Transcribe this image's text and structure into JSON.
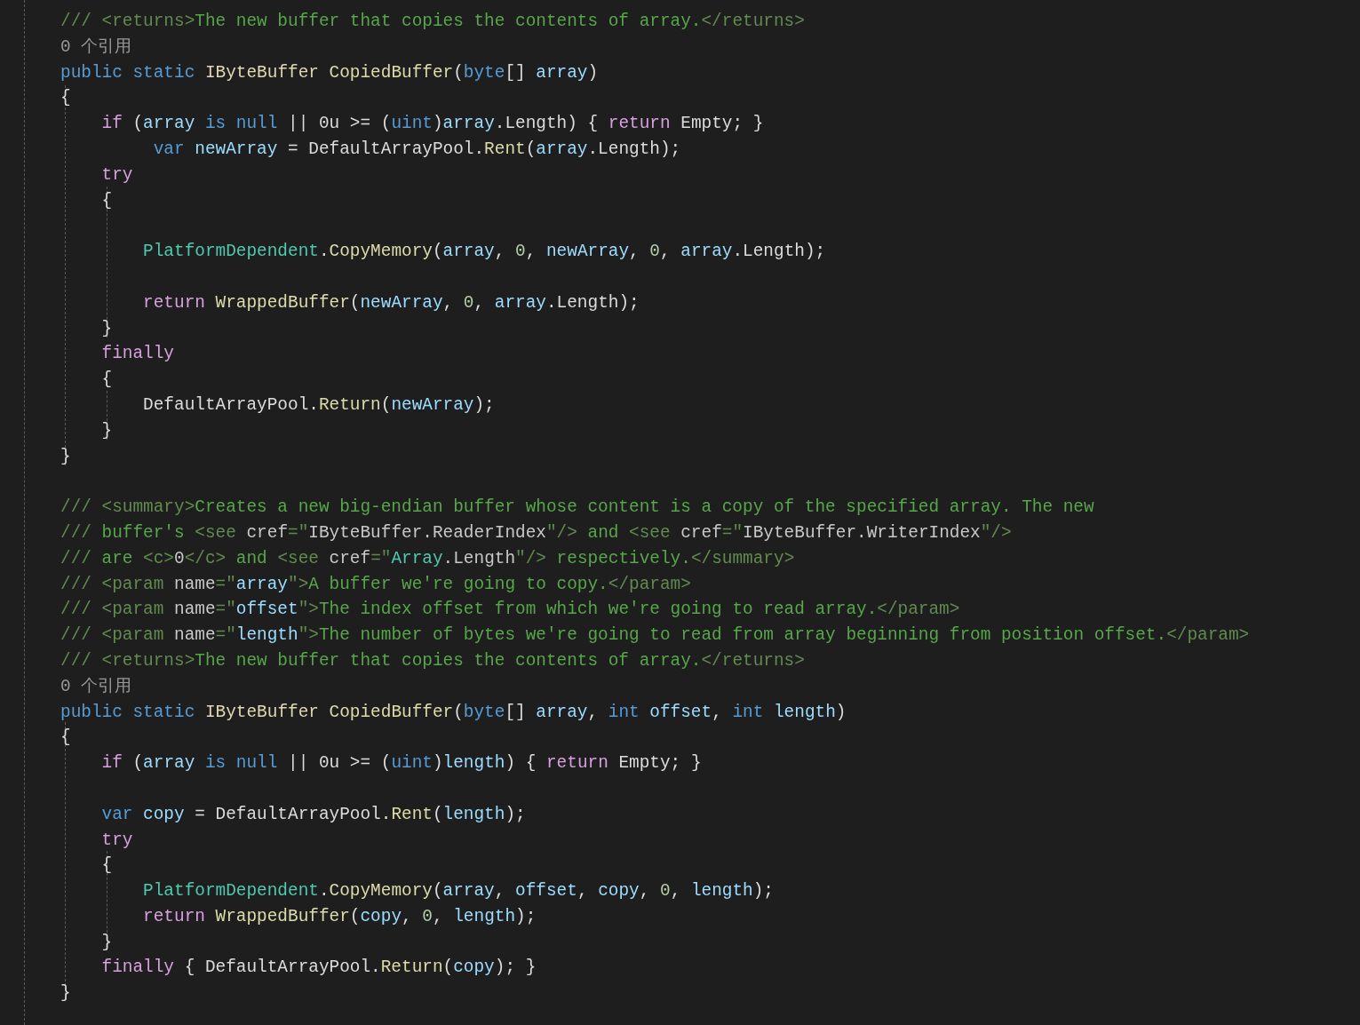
{
  "editor": {
    "lines": [
      {
        "kind": "code",
        "tokens": [
          {
            "text": "/// <returns>",
            "kind": "doc"
          },
          {
            "text": "The new buffer that copies the contents of array.",
            "kind": "comment"
          },
          {
            "text": "</returns>",
            "kind": "doc"
          }
        ]
      },
      {
        "kind": "lens",
        "text": "0 个引用"
      },
      {
        "kind": "code",
        "tokens": [
          {
            "text": "public static ",
            "kind": "keyword"
          },
          {
            "text": "IByteBuffer ",
            "kind": "interface"
          },
          {
            "text": "CopiedBuffer",
            "kind": "method"
          },
          {
            "text": "(",
            "kind": "plain"
          },
          {
            "text": "byte",
            "kind": "keyword"
          },
          {
            "text": "[] ",
            "kind": "plain"
          },
          {
            "text": "array",
            "kind": "variable"
          },
          {
            "text": ")",
            "kind": "plain"
          }
        ]
      },
      {
        "kind": "code",
        "tokens": [
          {
            "text": "{",
            "kind": "plain"
          }
        ]
      },
      {
        "kind": "code",
        "tokens": [
          {
            "text": "    if ",
            "kind": "control"
          },
          {
            "text": "(",
            "kind": "plain"
          },
          {
            "text": "array ",
            "kind": "variable"
          },
          {
            "text": "is null ",
            "kind": "keyword"
          },
          {
            "text": "|| 0u >= (",
            "kind": "plain"
          },
          {
            "text": "uint",
            "kind": "keyword"
          },
          {
            "text": ")",
            "kind": "plain"
          },
          {
            "text": "array",
            "kind": "variable"
          },
          {
            "text": ".Length) { ",
            "kind": "plain"
          },
          {
            "text": "return ",
            "kind": "control"
          },
          {
            "text": "Empty; }",
            "kind": "plain"
          }
        ]
      },
      {
        "kind": "code",
        "tokens": [
          {
            "text": "         var ",
            "kind": "keyword"
          },
          {
            "text": "newArray ",
            "kind": "variable"
          },
          {
            "text": "= DefaultArrayPool.",
            "kind": "plain"
          },
          {
            "text": "Rent",
            "kind": "method"
          },
          {
            "text": "(",
            "kind": "plain"
          },
          {
            "text": "array",
            "kind": "variable"
          },
          {
            "text": ".Length);",
            "kind": "plain"
          }
        ]
      },
      {
        "kind": "code",
        "tokens": [
          {
            "text": "    try",
            "kind": "control"
          }
        ]
      },
      {
        "kind": "code",
        "tokens": [
          {
            "text": "    {",
            "kind": "plain"
          }
        ]
      },
      {
        "kind": "blank"
      },
      {
        "kind": "code",
        "tokens": [
          {
            "text": "        PlatformDependent",
            "kind": "type"
          },
          {
            "text": ".",
            "kind": "plain"
          },
          {
            "text": "CopyMemory",
            "kind": "method"
          },
          {
            "text": "(",
            "kind": "plain"
          },
          {
            "text": "array",
            "kind": "variable"
          },
          {
            "text": ", ",
            "kind": "plain"
          },
          {
            "text": "0",
            "kind": "number"
          },
          {
            "text": ", ",
            "kind": "plain"
          },
          {
            "text": "newArray",
            "kind": "variable"
          },
          {
            "text": ", ",
            "kind": "plain"
          },
          {
            "text": "0",
            "kind": "number"
          },
          {
            "text": ", ",
            "kind": "plain"
          },
          {
            "text": "array",
            "kind": "variable"
          },
          {
            "text": ".Length);",
            "kind": "plain"
          }
        ]
      },
      {
        "kind": "blank"
      },
      {
        "kind": "code",
        "tokens": [
          {
            "text": "        return ",
            "kind": "control"
          },
          {
            "text": "WrappedBuffer",
            "kind": "method"
          },
          {
            "text": "(",
            "kind": "plain"
          },
          {
            "text": "newArray",
            "kind": "variable"
          },
          {
            "text": ", ",
            "kind": "plain"
          },
          {
            "text": "0",
            "kind": "number"
          },
          {
            "text": ", ",
            "kind": "plain"
          },
          {
            "text": "array",
            "kind": "variable"
          },
          {
            "text": ".Length);",
            "kind": "plain"
          }
        ]
      },
      {
        "kind": "code",
        "tokens": [
          {
            "text": "    }",
            "kind": "plain"
          }
        ]
      },
      {
        "kind": "code",
        "tokens": [
          {
            "text": "    finally",
            "kind": "control"
          }
        ]
      },
      {
        "kind": "code",
        "tokens": [
          {
            "text": "    {",
            "kind": "plain"
          }
        ]
      },
      {
        "kind": "code",
        "tokens": [
          {
            "text": "        DefaultArrayPool.",
            "kind": "plain"
          },
          {
            "text": "Return",
            "kind": "method"
          },
          {
            "text": "(",
            "kind": "plain"
          },
          {
            "text": "newArray",
            "kind": "variable"
          },
          {
            "text": ");",
            "kind": "plain"
          }
        ]
      },
      {
        "kind": "code",
        "tokens": [
          {
            "text": "    }",
            "kind": "plain"
          }
        ]
      },
      {
        "kind": "code",
        "tokens": [
          {
            "text": "}",
            "kind": "plain"
          }
        ]
      },
      {
        "kind": "blank"
      },
      {
        "kind": "code",
        "tokens": [
          {
            "text": "/// <summary>",
            "kind": "doc"
          },
          {
            "text": "Creates a new big-endian buffer whose content is a copy of the specified array. The new",
            "kind": "comment"
          }
        ]
      },
      {
        "kind": "code",
        "tokens": [
          {
            "text": "/// ",
            "kind": "doc"
          },
          {
            "text": "buffer's ",
            "kind": "comment"
          },
          {
            "text": "<see ",
            "kind": "doc"
          },
          {
            "text": "cref",
            "kind": "attribute"
          },
          {
            "text": "=\"",
            "kind": "doc"
          },
          {
            "text": "IByteBuffer.ReaderIndex",
            "kind": "attribute"
          },
          {
            "text": "\"/>",
            "kind": "doc"
          },
          {
            "text": " and ",
            "kind": "comment"
          },
          {
            "text": "<see ",
            "kind": "doc"
          },
          {
            "text": "cref",
            "kind": "attribute"
          },
          {
            "text": "=\"",
            "kind": "doc"
          },
          {
            "text": "IByteBuffer.WriterIndex",
            "kind": "attribute"
          },
          {
            "text": "\"/>",
            "kind": "doc"
          }
        ]
      },
      {
        "kind": "code",
        "tokens": [
          {
            "text": "/// ",
            "kind": "doc"
          },
          {
            "text": "are ",
            "kind": "comment"
          },
          {
            "text": "<c>",
            "kind": "doc"
          },
          {
            "text": "0",
            "kind": "attribute"
          },
          {
            "text": "</c>",
            "kind": "doc"
          },
          {
            "text": " and ",
            "kind": "comment"
          },
          {
            "text": "<see ",
            "kind": "doc"
          },
          {
            "text": "cref",
            "kind": "attribute"
          },
          {
            "text": "=\"",
            "kind": "doc"
          },
          {
            "text": "Array",
            "kind": "type"
          },
          {
            "text": ".Length",
            "kind": "attribute"
          },
          {
            "text": "\"/>",
            "kind": "doc"
          },
          {
            "text": " respectively.",
            "kind": "comment"
          },
          {
            "text": "</summary>",
            "kind": "doc"
          }
        ]
      },
      {
        "kind": "code",
        "tokens": [
          {
            "text": "/// <param ",
            "kind": "doc"
          },
          {
            "text": "name",
            "kind": "attribute"
          },
          {
            "text": "=\"",
            "kind": "doc"
          },
          {
            "text": "array",
            "kind": "variable"
          },
          {
            "text": "\">",
            "kind": "doc"
          },
          {
            "text": "A buffer we're going to copy.",
            "kind": "comment"
          },
          {
            "text": "</param>",
            "kind": "doc"
          }
        ]
      },
      {
        "kind": "code",
        "tokens": [
          {
            "text": "/// <param ",
            "kind": "doc"
          },
          {
            "text": "name",
            "kind": "attribute"
          },
          {
            "text": "=\"",
            "kind": "doc"
          },
          {
            "text": "offset",
            "kind": "variable"
          },
          {
            "text": "\">",
            "kind": "doc"
          },
          {
            "text": "The index offset from which we're going to read array.",
            "kind": "comment"
          },
          {
            "text": "</param>",
            "kind": "doc"
          }
        ]
      },
      {
        "kind": "code",
        "tokens": [
          {
            "text": "/// <param ",
            "kind": "doc"
          },
          {
            "text": "name",
            "kind": "attribute"
          },
          {
            "text": "=\"",
            "kind": "doc"
          },
          {
            "text": "length",
            "kind": "variable"
          },
          {
            "text": "\">",
            "kind": "doc"
          },
          {
            "text": "The number of bytes we're going to read from array beginning from position offset.",
            "kind": "comment"
          },
          {
            "text": "</param>",
            "kind": "doc"
          }
        ]
      },
      {
        "kind": "code",
        "tokens": [
          {
            "text": "/// <returns>",
            "kind": "doc"
          },
          {
            "text": "The new buffer that copies the contents of array.",
            "kind": "comment"
          },
          {
            "text": "</returns>",
            "kind": "doc"
          }
        ]
      },
      {
        "kind": "lens",
        "text": "0 个引用"
      },
      {
        "kind": "code",
        "tokens": [
          {
            "text": "public static ",
            "kind": "keyword"
          },
          {
            "text": "IByteBuffer ",
            "kind": "interface"
          },
          {
            "text": "CopiedBuffer",
            "kind": "method"
          },
          {
            "text": "(",
            "kind": "plain"
          },
          {
            "text": "byte",
            "kind": "keyword"
          },
          {
            "text": "[] ",
            "kind": "plain"
          },
          {
            "text": "array",
            "kind": "variable"
          },
          {
            "text": ", ",
            "kind": "plain"
          },
          {
            "text": "int ",
            "kind": "keyword"
          },
          {
            "text": "offset",
            "kind": "variable"
          },
          {
            "text": ", ",
            "kind": "plain"
          },
          {
            "text": "int ",
            "kind": "keyword"
          },
          {
            "text": "length",
            "kind": "variable"
          },
          {
            "text": ")",
            "kind": "plain"
          }
        ]
      },
      {
        "kind": "code",
        "tokens": [
          {
            "text": "{",
            "kind": "plain"
          }
        ]
      },
      {
        "kind": "code",
        "tokens": [
          {
            "text": "    if ",
            "kind": "control"
          },
          {
            "text": "(",
            "kind": "plain"
          },
          {
            "text": "array ",
            "kind": "variable"
          },
          {
            "text": "is null ",
            "kind": "keyword"
          },
          {
            "text": "|| 0u >= (",
            "kind": "plain"
          },
          {
            "text": "uint",
            "kind": "keyword"
          },
          {
            "text": ")",
            "kind": "plain"
          },
          {
            "text": "length",
            "kind": "variable"
          },
          {
            "text": ") { ",
            "kind": "plain"
          },
          {
            "text": "return ",
            "kind": "control"
          },
          {
            "text": "Empty; }",
            "kind": "plain"
          }
        ]
      },
      {
        "kind": "blank"
      },
      {
        "kind": "code",
        "tokens": [
          {
            "text": "    var ",
            "kind": "keyword"
          },
          {
            "text": "copy ",
            "kind": "variable"
          },
          {
            "text": "= DefaultArrayPool.",
            "kind": "plain"
          },
          {
            "text": "Rent",
            "kind": "method"
          },
          {
            "text": "(",
            "kind": "plain"
          },
          {
            "text": "length",
            "kind": "variable"
          },
          {
            "text": ");",
            "kind": "plain"
          }
        ]
      },
      {
        "kind": "code",
        "tokens": [
          {
            "text": "    try",
            "kind": "control"
          }
        ]
      },
      {
        "kind": "code",
        "tokens": [
          {
            "text": "    {",
            "kind": "plain"
          }
        ]
      },
      {
        "kind": "code",
        "tokens": [
          {
            "text": "        PlatformDependent",
            "kind": "type"
          },
          {
            "text": ".",
            "kind": "plain"
          },
          {
            "text": "CopyMemory",
            "kind": "method"
          },
          {
            "text": "(",
            "kind": "plain"
          },
          {
            "text": "array",
            "kind": "variable"
          },
          {
            "text": ", ",
            "kind": "plain"
          },
          {
            "text": "offset",
            "kind": "variable"
          },
          {
            "text": ", ",
            "kind": "plain"
          },
          {
            "text": "copy",
            "kind": "variable"
          },
          {
            "text": ", ",
            "kind": "plain"
          },
          {
            "text": "0",
            "kind": "number"
          },
          {
            "text": ", ",
            "kind": "plain"
          },
          {
            "text": "length",
            "kind": "variable"
          },
          {
            "text": ");",
            "kind": "plain"
          }
        ]
      },
      {
        "kind": "code",
        "tokens": [
          {
            "text": "        return ",
            "kind": "control"
          },
          {
            "text": "WrappedBuffer",
            "kind": "method"
          },
          {
            "text": "(",
            "kind": "plain"
          },
          {
            "text": "copy",
            "kind": "variable"
          },
          {
            "text": ", ",
            "kind": "plain"
          },
          {
            "text": "0",
            "kind": "number"
          },
          {
            "text": ", ",
            "kind": "plain"
          },
          {
            "text": "length",
            "kind": "variable"
          },
          {
            "text": ");",
            "kind": "plain"
          }
        ]
      },
      {
        "kind": "code",
        "tokens": [
          {
            "text": "    }",
            "kind": "plain"
          }
        ]
      },
      {
        "kind": "code",
        "tokens": [
          {
            "text": "    finally ",
            "kind": "control"
          },
          {
            "text": "{ DefaultArrayPool.",
            "kind": "plain"
          },
          {
            "text": "Return",
            "kind": "method"
          },
          {
            "text": "(",
            "kind": "plain"
          },
          {
            "text": "copy",
            "kind": "variable"
          },
          {
            "text": "); }",
            "kind": "plain"
          }
        ]
      },
      {
        "kind": "code",
        "tokens": [
          {
            "text": "}",
            "kind": "plain"
          }
        ]
      }
    ]
  }
}
